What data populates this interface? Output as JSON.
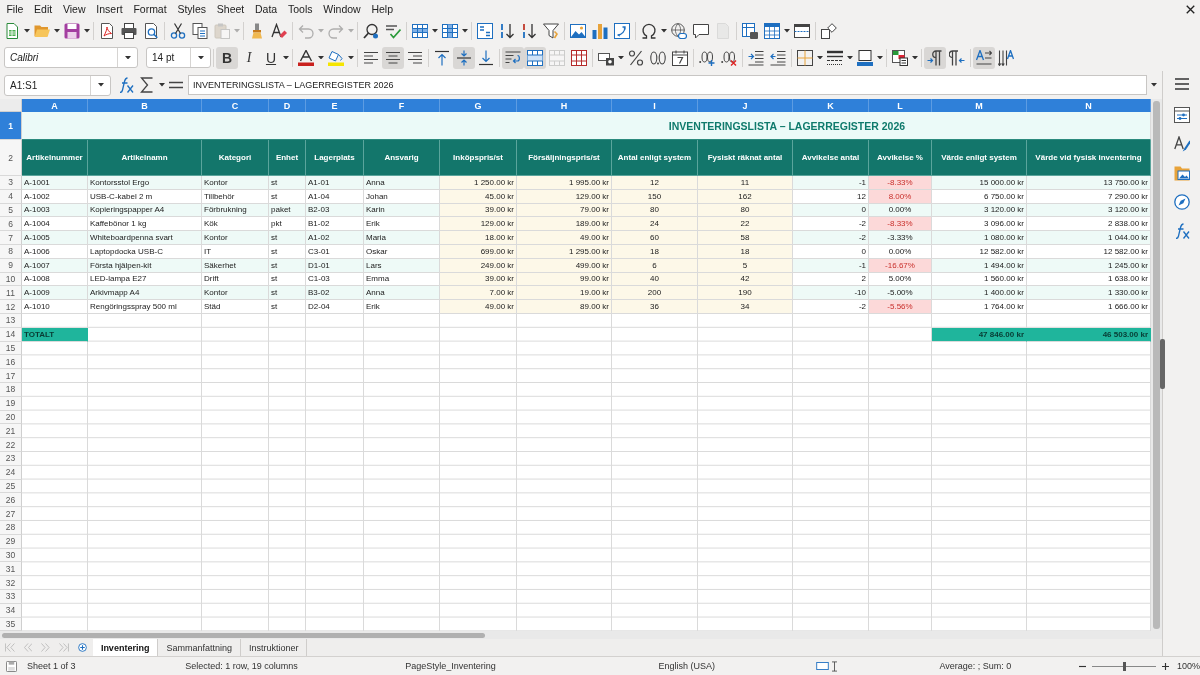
{
  "menu": [
    "File",
    "Edit",
    "View",
    "Insert",
    "Format",
    "Styles",
    "Sheet",
    "Data",
    "Tools",
    "Window",
    "Help"
  ],
  "standard_toolbar": {
    "paste": {
      "disabled": true
    },
    "undo": {
      "disabled": true
    },
    "redo": {
      "disabled": true
    },
    "blank_page": {
      "disabled": true
    }
  },
  "formatting_toolbar": {
    "font_name": "Calibri",
    "font_size": "14 pt",
    "bold": {
      "label": "B",
      "on": true
    },
    "italic": {
      "label": "I",
      "on": false
    },
    "underline": {
      "label": "U",
      "on": false
    },
    "align_left": {
      "on": false
    },
    "align_center": {
      "on": true
    },
    "align_right": {
      "on": false
    },
    "align_top": {
      "on": false
    },
    "align_middle": {
      "on": true
    },
    "align_bottom": {
      "on": false
    },
    "wrap_text": {
      "on": true
    },
    "merge_and_center": {
      "on": true
    },
    "merge_cells": {
      "disabled": true
    },
    "left_to_right": {
      "on": true
    },
    "right_to_left": {
      "on": false
    },
    "text_horizontal": {
      "on": true
    },
    "text_vertical": {
      "on": false
    }
  },
  "formula_bar": {
    "name_box": "A1:S1",
    "content": "INVENTERINGSLISTA – LAGERREGISTER 2026"
  },
  "sheet": {
    "columns": [
      {
        "label": "A",
        "selected": true
      },
      {
        "label": "B",
        "selected": true
      },
      {
        "label": "C",
        "selected": true
      },
      {
        "label": "D",
        "selected": true
      },
      {
        "label": "E",
        "selected": true
      },
      {
        "label": "F",
        "selected": true
      },
      {
        "label": "G",
        "selected": true
      },
      {
        "label": "H",
        "selected": true
      },
      {
        "label": "I",
        "selected": true
      },
      {
        "label": "J",
        "selected": true
      },
      {
        "label": "K",
        "selected": true
      },
      {
        "label": "L",
        "selected": true
      },
      {
        "label": "M",
        "selected": true
      },
      {
        "label": "N",
        "selected": true
      }
    ],
    "rows": [
      {
        "number": "1",
        "selected": true,
        "kind": "title",
        "text": "INVENTERINGSLISTA – LAGERREGISTER 2026"
      },
      {
        "number": "2",
        "selected": false,
        "kind": "header",
        "cells": [
          "Artikelnummer",
          "Artikelnamn",
          "Kategori",
          "Enhet",
          "Lagerplats",
          "Ansvarig",
          "Inköpspris/st",
          "Försäljningspris/st",
          "Antal enligt system",
          "Fysiskt räknat antal",
          "Avvikelse antal",
          "Avvikelse %",
          "Värde enligt system",
          "Värde vid fysisk inventering"
        ]
      },
      {
        "number": "3",
        "selected": false,
        "kind": "data",
        "flagged": true,
        "cells": [
          "A-1001",
          "Kontorsstol Ergo",
          "Kontor",
          "st",
          "A1-01",
          "Anna",
          "1 250.00 kr",
          "1 995.00 kr",
          "12",
          "11",
          "-1",
          "-8.33%",
          "15 000.00 kr",
          "13 750.00 kr"
        ]
      },
      {
        "number": "4",
        "selected": false,
        "kind": "data",
        "flagged": true,
        "cells": [
          "A-1002",
          "USB-C-kabel 2 m",
          "Tillbehör",
          "st",
          "A1-04",
          "Johan",
          "45.00 kr",
          "129.00 kr",
          "150",
          "162",
          "12",
          "8.00%",
          "6 750.00 kr",
          "7 290.00 kr"
        ]
      },
      {
        "number": "5",
        "selected": false,
        "kind": "data",
        "flagged": false,
        "cells": [
          "A-1003",
          "Kopieringspapper A4",
          "Förbrukning",
          "paket",
          "B2-03",
          "Karin",
          "39.00 kr",
          "79.00 kr",
          "80",
          "80",
          "0",
          "0.00%",
          "3 120.00 kr",
          "3 120.00 kr"
        ]
      },
      {
        "number": "6",
        "selected": false,
        "kind": "data",
        "flagged": true,
        "cells": [
          "A-1004",
          "Kaffebönor 1 kg",
          "Kök",
          "pkt",
          "B1-02",
          "Erik",
          "129.00 kr",
          "189.00 kr",
          "24",
          "22",
          "-2",
          "-8.33%",
          "3 096.00 kr",
          "2 838.00 kr"
        ]
      },
      {
        "number": "7",
        "selected": false,
        "kind": "data",
        "flagged": false,
        "cells": [
          "A-1005",
          "Whiteboardpenna svart",
          "Kontor",
          "st",
          "A1-02",
          "Maria",
          "18.00 kr",
          "49.00 kr",
          "60",
          "58",
          "-2",
          "-3.33%",
          "1 080.00 kr",
          "1 044.00 kr"
        ]
      },
      {
        "number": "8",
        "selected": false,
        "kind": "data",
        "flagged": false,
        "cells": [
          "A-1006",
          "Laptopdocka USB-C",
          "IT",
          "st",
          "C3-01",
          "Oskar",
          "699.00 kr",
          "1 295.00 kr",
          "18",
          "18",
          "0",
          "0.00%",
          "12 582.00 kr",
          "12 582.00 kr"
        ]
      },
      {
        "number": "9",
        "selected": false,
        "kind": "data",
        "flagged": true,
        "cells": [
          "A-1007",
          "Första hjälpen-kit",
          "Säkerhet",
          "st",
          "D1-01",
          "Lars",
          "249.00 kr",
          "499.00 kr",
          "6",
          "5",
          "-1",
          "-16.67%",
          "1 494.00 kr",
          "1 245.00 kr"
        ]
      },
      {
        "number": "10",
        "selected": false,
        "kind": "data",
        "flagged": false,
        "cells": [
          "A-1008",
          "LED-lampa E27",
          "Drift",
          "st",
          "C1-03",
          "Emma",
          "39.00 kr",
          "99.00 kr",
          "40",
          "42",
          "2",
          "5.00%",
          "1 560.00 kr",
          "1 638.00 kr"
        ]
      },
      {
        "number": "11",
        "selected": false,
        "kind": "data",
        "flagged": false,
        "cells": [
          "A-1009",
          "Arkivmapp A4",
          "Kontor",
          "st",
          "B3-02",
          "Anna",
          "7.00 kr",
          "19.00 kr",
          "200",
          "190",
          "-10",
          "-5.00%",
          "1 400.00 kr",
          "1 330.00 kr"
        ]
      },
      {
        "number": "12",
        "selected": false,
        "kind": "data",
        "flagged": true,
        "cells": [
          "A-1010",
          "Rengöringsspray 500 ml",
          "Städ",
          "st",
          "D2-04",
          "Erik",
          "49.00 kr",
          "89.00 kr",
          "36",
          "34",
          "-2",
          "-5.56%",
          "1 764.00 kr",
          "1 666.00 kr"
        ]
      },
      {
        "number": "13",
        "selected": false,
        "kind": "empty"
      },
      {
        "number": "14",
        "selected": false,
        "kind": "total",
        "label": "TOTALT",
        "system_value": "47 846.00 kr",
        "physical_value": "46 503.00 kr"
      },
      {
        "number": "15",
        "selected": false,
        "kind": "empty"
      },
      {
        "number": "16",
        "selected": false,
        "kind": "empty"
      },
      {
        "number": "17",
        "selected": false,
        "kind": "empty"
      },
      {
        "number": "18",
        "selected": false,
        "kind": "empty"
      },
      {
        "number": "19",
        "selected": false,
        "kind": "empty"
      },
      {
        "number": "20",
        "selected": false,
        "kind": "empty"
      },
      {
        "number": "21",
        "selected": false,
        "kind": "empty"
      },
      {
        "number": "22",
        "selected": false,
        "kind": "empty"
      },
      {
        "number": "23",
        "selected": false,
        "kind": "empty"
      },
      {
        "number": "24",
        "selected": false,
        "kind": "empty"
      },
      {
        "number": "25",
        "selected": false,
        "kind": "empty"
      },
      {
        "number": "26",
        "selected": false,
        "kind": "empty"
      },
      {
        "number": "27",
        "selected": false,
        "kind": "empty"
      },
      {
        "number": "28",
        "selected": false,
        "kind": "empty"
      },
      {
        "number": "29",
        "selected": false,
        "kind": "empty"
      },
      {
        "number": "30",
        "selected": false,
        "kind": "empty"
      },
      {
        "number": "31",
        "selected": false,
        "kind": "empty"
      },
      {
        "number": "32",
        "selected": false,
        "kind": "empty"
      },
      {
        "number": "33",
        "selected": false,
        "kind": "empty"
      },
      {
        "number": "34",
        "selected": false,
        "kind": "empty"
      },
      {
        "number": "35",
        "selected": false,
        "kind": "empty"
      }
    ]
  },
  "sheet_tabs": {
    "navigation": {
      "disabled": true
    },
    "tabs": [
      {
        "label": "Inventering",
        "selected": true
      },
      {
        "label": "Sammanfattning",
        "selected": false
      },
      {
        "label": "Instruktioner",
        "selected": false
      }
    ]
  },
  "status_bar": {
    "sheet_position": "Sheet 1 of 3",
    "selection": "Selected: 1 row, 19 columns",
    "page_style": "PageStyle_Inventering",
    "language": "English (USA)",
    "aggregate": "Average: ; Sum: 0",
    "zoom": {
      "level": 0.5,
      "reading": "100%"
    }
  }
}
